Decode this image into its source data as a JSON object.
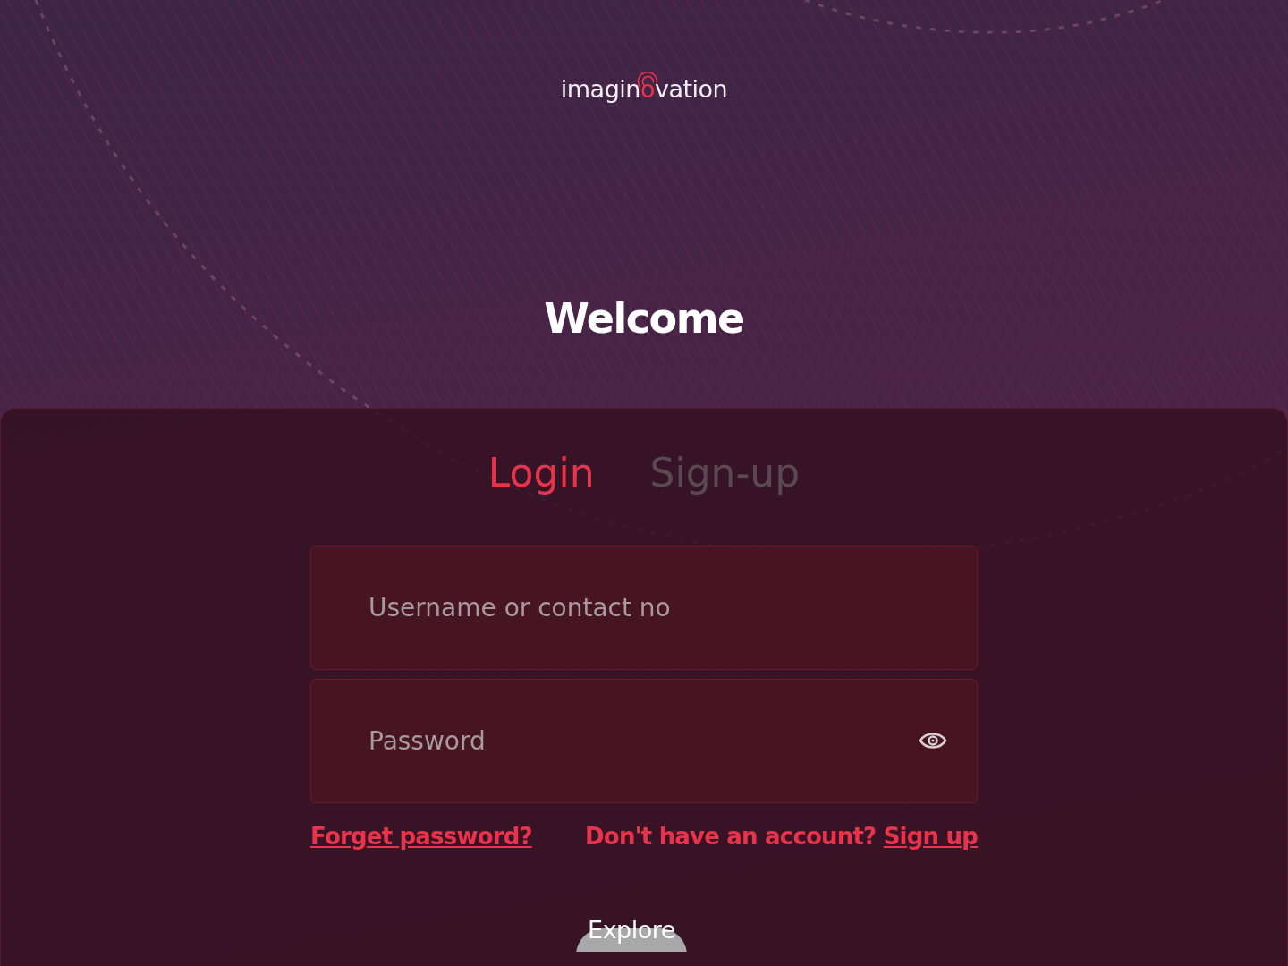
{
  "logo": {
    "text_start": "imagin",
    "mark": "o",
    "text_end": "vation"
  },
  "heading": "Welcome",
  "tabs": [
    {
      "label": "Login",
      "selected": true
    },
    {
      "label": "Sign-up",
      "selected": false
    }
  ],
  "fields": [
    {
      "placeholder": "Username or contact no",
      "kind": "text"
    },
    {
      "placeholder": "Password",
      "kind": "password"
    }
  ],
  "forgot_link": "Forget password?",
  "signup_prompt": {
    "text": "Don't have an account?",
    "link": "Sign up"
  },
  "explore_button": "Explore"
}
